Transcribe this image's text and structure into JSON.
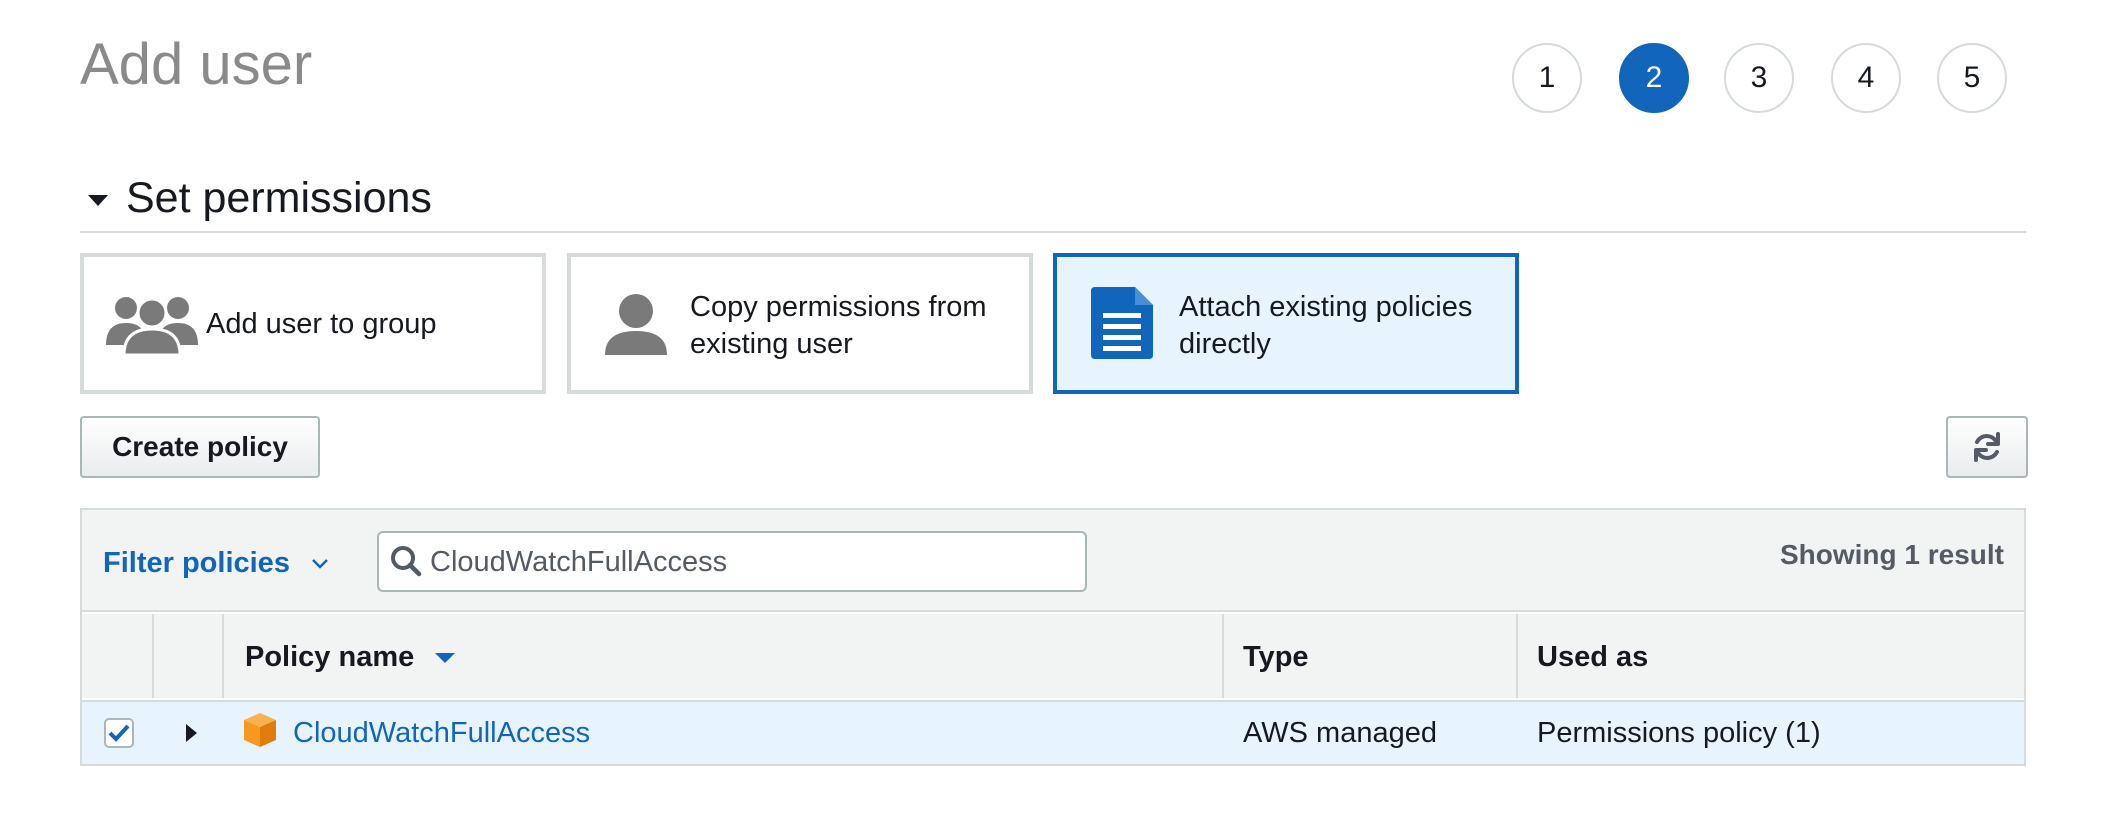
{
  "page": {
    "title": "Add user"
  },
  "steps": [
    "1",
    "2",
    "3",
    "4",
    "5"
  ],
  "active_step": "2",
  "section": {
    "title": "Set permissions"
  },
  "options": [
    {
      "label_line1": "Add user to group",
      "label_line2": "",
      "icon": "users-group-icon"
    },
    {
      "label_line1": "Copy permissions from",
      "label_line2": "existing user",
      "icon": "user-icon"
    },
    {
      "label_line1": "Attach existing policies",
      "label_line2": "directly",
      "icon": "document-icon"
    }
  ],
  "selected_option": "Attach existing policies directly",
  "toolbar": {
    "create_policy_label": "Create policy",
    "refresh_icon": "refresh-icon"
  },
  "filter": {
    "label": "Filter policies",
    "search_value": "CloudWatchFullAccess",
    "result_count": "Showing 1 result"
  },
  "table": {
    "columns": [
      "Policy name",
      "Type",
      "Used as"
    ],
    "rows": [
      {
        "checked": true,
        "name": "CloudWatchFullAccess",
        "type": "AWS managed",
        "used_as": "Permissions policy (1)"
      }
    ]
  },
  "colors": {
    "accent": "#1166bb",
    "selected_bg": "#e8f4fd",
    "border": "#d5dbdb",
    "policy_icon": "#f7981f"
  }
}
